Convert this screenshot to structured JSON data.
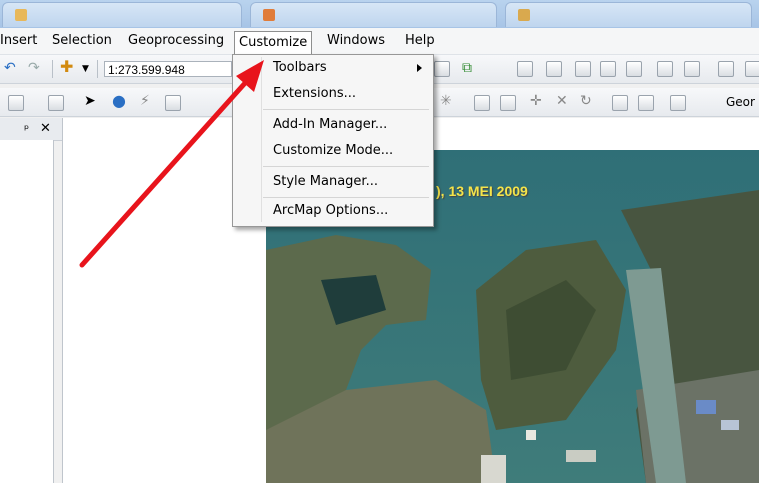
{
  "menubar": {
    "items": [
      "Insert",
      "Selection",
      "Geoprocessing",
      "Customize",
      "Windows",
      "Help"
    ],
    "active": "Customize"
  },
  "toolbar": {
    "scale_value": "1:273.599.948",
    "georef_label": "Geor"
  },
  "dropdown": {
    "items": [
      "Toolbars",
      "Extensions...",
      "Add-In Manager...",
      "Customize Mode...",
      "Style Manager...",
      "ArcMap Options..."
    ]
  },
  "map": {
    "photo_caption": "), 13 MEI 2009"
  },
  "colors": {
    "annotation_arrow": "#e8141c",
    "caption_text": "#f4e44a"
  },
  "icons": {
    "panel_pin": "pin-icon",
    "panel_close": "close-icon"
  }
}
